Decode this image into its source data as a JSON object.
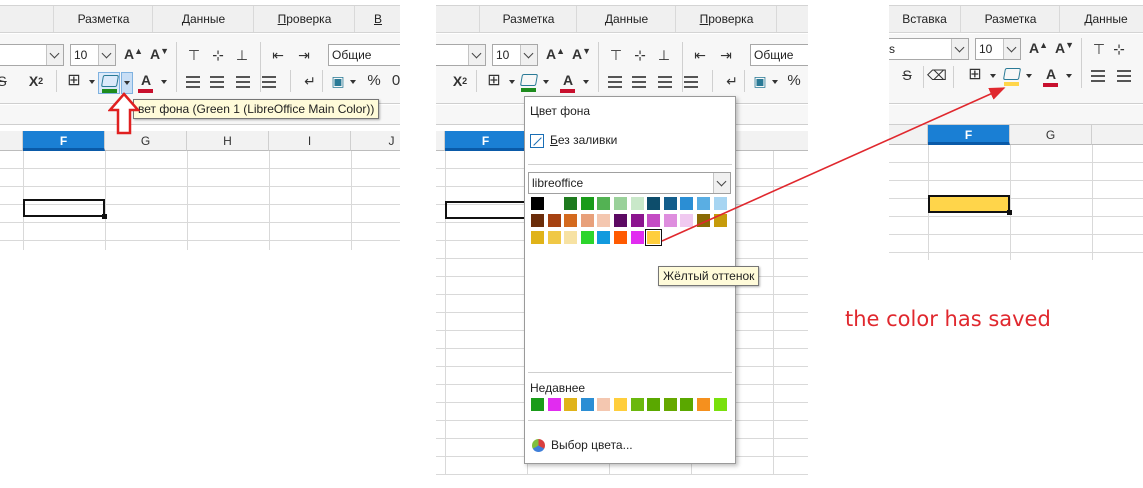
{
  "tabs_left": {
    "razmetka": "Разметка",
    "dannye": "Данные",
    "proverka": "Проверка",
    "v": "В"
  },
  "tabs_mid": {
    "razmetka": "Разметка",
    "dannye": "Данные",
    "proverka": "Проверка"
  },
  "tabs_right": {
    "vstavka": "Вставка",
    "razmetka": "Разметка",
    "dannye": "Данные"
  },
  "toolbar": {
    "font_size": "10",
    "number_format": "Общие",
    "percent": "%",
    "zero": "0",
    "font_name_right": "s"
  },
  "tooltip_bg": "вет фона (Green 1 (LibreOffice Main Color))",
  "columns_left": [
    "F",
    "G",
    "H",
    "I",
    "J"
  ],
  "columns_mid": [
    "F"
  ],
  "columns_right": [
    "F",
    "G"
  ],
  "popup": {
    "title": "Цвет фона",
    "no_fill_prefix": "Б",
    "no_fill_rest": "ез заливки",
    "palette": "libreoffice",
    "recent_label": "Недавнее",
    "picker_label": "Выбор цвета..."
  },
  "swatch_tooltip": "Жёлтый оттенок",
  "annotation": "the color has saved",
  "colors": {
    "palette_rows": [
      [
        "#000000",
        "#ffffff",
        "#1e7a1e",
        "#199b19",
        "#53b253",
        "#9ad19a",
        "#c9e8c9",
        "#0d4d6b",
        "#145e8c",
        "#2b8ed4",
        "#5aaee3",
        "#a7d5f2"
      ],
      [
        "#6b2d0a",
        "#a64211",
        "#d46a1e",
        "#e8a07a",
        "#f4c7b0",
        "#5c0a63",
        "#8c148f",
        "#c44cc4",
        "#de8ede",
        "#f0c9f0",
        "#8a6a05",
        "#c69b0b"
      ],
      [
        "#e0b319",
        "#f0c846",
        "#f7e2a3",
        "#2cd52c",
        "#129ade",
        "#ff5a00",
        "#e12cf0",
        "#ffce3c"
      ]
    ],
    "recent": [
      "#199b19",
      "#e12cf0",
      "#e0b319",
      "#2b8ed4",
      "#f4c7b0",
      "#ffce3c",
      "#6bb80e",
      "#5aa800",
      "#66a800",
      "#5aa800",
      "#f5901e",
      "#79e00c"
    ],
    "selected_cell_fill": "#ffd54a",
    "accent_green": "#1e8c1e",
    "accent_red": "#c8102e",
    "annotation_red": "#e0282e"
  }
}
